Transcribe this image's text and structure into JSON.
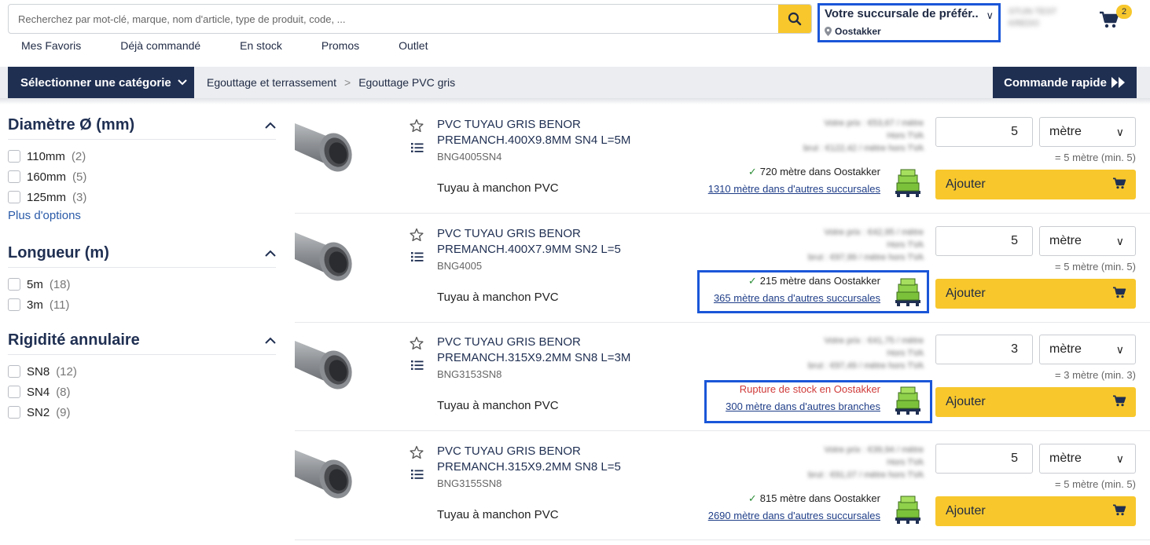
{
  "search": {
    "placeholder": "Recherchez par mot-clé, marque, nom d'article, type de produit, code, ..."
  },
  "branch": {
    "title": "Votre succursale de préfér...",
    "location": "Oostakker"
  },
  "user": {
    "line1": "STIJN TEST",
    "line2": "KREDO"
  },
  "cart": {
    "count": "2"
  },
  "topnav": [
    "Mes Favoris",
    "Déjà commandé",
    "En stock",
    "Promos",
    "Outlet"
  ],
  "catbar": {
    "select_label": "Sélectionner une catégorie",
    "breadcrumb": [
      "Egouttage et terrassement",
      "Egouttage PVC gris"
    ],
    "quick_order": "Commande rapide"
  },
  "filters": [
    {
      "title": "Diamètre Ø (mm)",
      "options": [
        {
          "label": "110mm",
          "count": "(2)"
        },
        {
          "label": "160mm",
          "count": "(5)"
        },
        {
          "label": "125mm",
          "count": "(3)"
        }
      ],
      "more": "Plus d'options"
    },
    {
      "title": "Longueur (m)",
      "options": [
        {
          "label": "5m",
          "count": "(18)"
        },
        {
          "label": "3m",
          "count": "(11)"
        }
      ]
    },
    {
      "title": "Rigidité annulaire",
      "options": [
        {
          "label": "SN8",
          "count": "(12)"
        },
        {
          "label": "SN4",
          "count": "(8)"
        },
        {
          "label": "SN2",
          "count": "(9)"
        }
      ]
    }
  ],
  "products": [
    {
      "name": "PVC TUYAU GRIS BENOR PREMANCH.400X9.8MM SN4 L=5M",
      "code": "BNG4005SN4",
      "desc": "Tuyau à manchon PVC",
      "price1": "Votre prix : €53,67 / mètre",
      "price2": "Hors TVA",
      "price3": "brut : €122,42 / mètre hors TVA",
      "stock_local": "720 mètre dans Oostakker",
      "stock_other": "1310 mètre dans d'autres succursales",
      "qty": "5",
      "unit": "mètre",
      "min": "= 5 mètre (min. 5)",
      "add": "Ajouter"
    },
    {
      "name": "PVC TUYAU GRIS BENOR PREMANCH.400X7.9MM SN2 L=5",
      "code": "BNG4005",
      "desc": "Tuyau à manchon PVC",
      "price1": "Votre prix : €42,95 / mètre",
      "price2": "Hors TVA",
      "price3": "brut : €97,99 / mètre hors TVA",
      "stock_local": "215 mètre dans Oostakker",
      "stock_other": "365 mètre dans d'autres succursales",
      "qty": "5",
      "unit": "mètre",
      "min": "= 5 mètre (min. 5)",
      "add": "Ajouter"
    },
    {
      "name": "PVC TUYAU GRIS BENOR PREMANCH.315X9.2MM SN8 L=3M",
      "code": "BNG3153SN8",
      "desc": "Tuyau à manchon PVC",
      "price1": "Votre prix : €41,75 / mètre",
      "price2": "Hors TVA",
      "price3": "brut : €97,49 / mètre hors TVA",
      "stock_out": "Rupture de stock en Oostakker",
      "stock_other": "300 mètre dans d'autres branches",
      "qty": "3",
      "unit": "mètre",
      "min": "= 3 mètre (min. 3)",
      "add": "Ajouter"
    },
    {
      "name": "PVC TUYAU GRIS BENOR PREMANCH.315X9.2MM SN8 L=5",
      "code": "BNG3155SN8",
      "desc": "Tuyau à manchon PVC",
      "price1": "Votre prix : €39,94 / mètre",
      "price2": "Hors TVA",
      "price3": "brut : €91,07 / mètre hors TVA",
      "stock_local": "815 mètre dans Oostakker",
      "stock_other": "2690 mètre dans d'autres succursales",
      "qty": "5",
      "unit": "mètre",
      "min": "= 5 mètre (min. 5)",
      "add": "Ajouter"
    }
  ],
  "colors": {
    "navy": "#1f2f52",
    "yellow": "#f7c72c",
    "highlight": "#1a56d8",
    "out_of_stock": "#d03a3a",
    "in_stock": "#2f8f3a"
  },
  "icons": [
    "search-icon",
    "chevron-down-icon",
    "location-pin-icon",
    "cart-icon",
    "fast-forward-icon",
    "chevron-up-icon",
    "star-icon",
    "list-icon",
    "check-icon",
    "pallet-icon"
  ]
}
